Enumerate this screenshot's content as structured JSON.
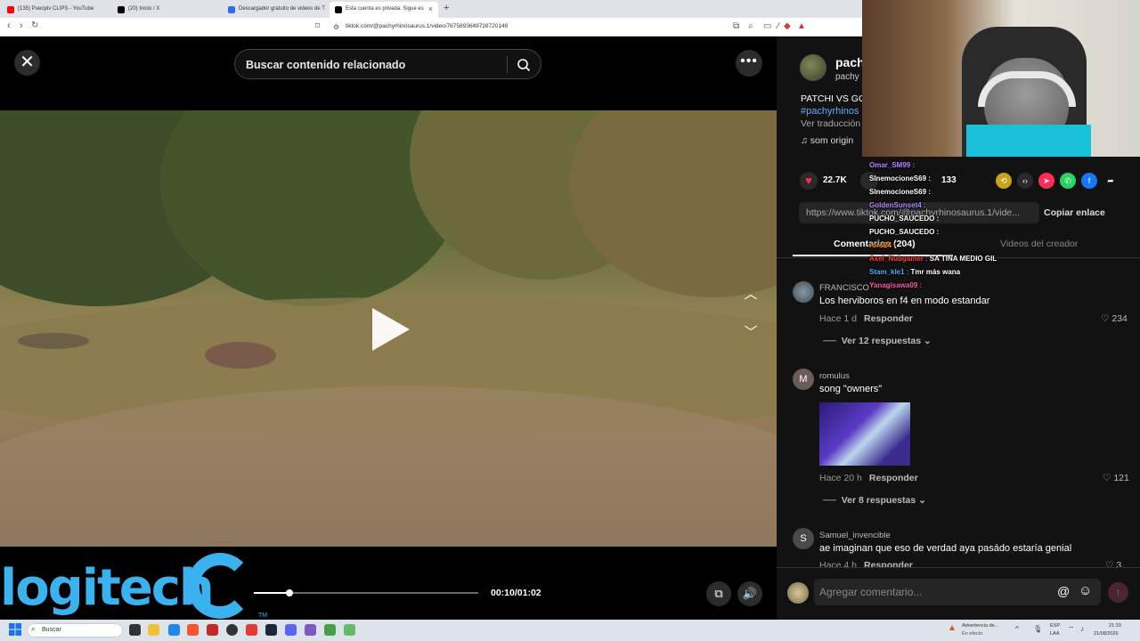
{
  "browser": {
    "tabs": [
      {
        "label": "(135) Pueoplv CLIPS - YouTube",
        "color": "#ff0000"
      },
      {
        "label": "(20) Inicio / X",
        "color": "#000000"
      },
      {
        "label": "Descargador gratuito de videos de T",
        "color": "#2a6df4"
      },
      {
        "label": "Esta cuenta es privada. Sigue es",
        "color": "#000000"
      }
    ],
    "new_tab": "+",
    "url": "tiktok.com/@pachyrhinosaurus.1/video/7675893649728720149"
  },
  "tiktok": {
    "search_placeholder": "Buscar contenido relacionado",
    "more_label": "•••",
    "time": "00:10/01:02",
    "progress": 0.16,
    "author_name": "pach",
    "author_handle": "pachy",
    "description": "PATCHI VS GO",
    "hashtag": "#pachyrhinos",
    "translate": "Ver traducción",
    "sound": "♫  som origin",
    "likes": "22.7K",
    "comments_count": "133",
    "link": "https://www.tiktok.com/@pachyrhinosaurus.1/vide...",
    "copy_link": "Copiar enlace",
    "tab_comments": "Comentarios (204)",
    "tab_creator": "Videos del creador",
    "comments": [
      {
        "avatar": "",
        "user": "FRANCISCO",
        "text": "Los herviboros en f4 en modo estandar",
        "time": "Hace 1 d",
        "reply": "Responder",
        "likes": "234",
        "more": "Ver 12 respuestas"
      },
      {
        "avatar": "M",
        "user": "romulus",
        "text": "song \"owners\"",
        "time": "Hace 20 h",
        "reply": "Responder",
        "likes": "121",
        "more": "Ver 8 respuestas"
      },
      {
        "avatar": "S",
        "user": "Samuel_invencible",
        "text": "ae imaginan que eso de verdad aya pasádo estaría genial",
        "time": "Hace 4 h",
        "reply": "Responder",
        "likes": "3"
      }
    ],
    "composer_placeholder": "Agregar comentario...",
    "accent": "#fe2c55"
  },
  "overlay": {
    "logo": "logitech",
    "logo_tm": "TM",
    "chat": [
      {
        "user": "Omar_SM99 :",
        "msg": "",
        "color": "#b784ff"
      },
      {
        "user": "SInemocioneS69 :",
        "msg": "",
        "color": "#ffffff"
      },
      {
        "user": "SInemocioneS69 :",
        "msg": "",
        "color": "#ffffff"
      },
      {
        "user": "GoldenSunset4 :",
        "msg": "",
        "color": "#b784ff"
      },
      {
        "user": "PUCHO_SAUCEDO :",
        "msg": "",
        "color": "#ffffff"
      },
      {
        "user": "PUCHO_SAUCEDO :",
        "msg": "",
        "color": "#ffffff"
      },
      {
        "user": "roro24 :",
        "msg": "",
        "color": "#ff8c1a"
      },
      {
        "user": "Axel_Nubgamer :",
        "msg": "SA TINA MEDIO GIL",
        "color": "#ff4040"
      },
      {
        "user": "Stam_kle1 :",
        "msg": "Tmr más wana",
        "color": "#3db0ff"
      },
      {
        "user": "Yanagisawa09 :",
        "msg": "",
        "color": "#ff5aa0"
      }
    ]
  },
  "taskbar": {
    "search": "Buscar",
    "alert_title": "Advertencia de...",
    "alert_sub": "En efecto",
    "lang": "ESP",
    "lang_sub": "LAA",
    "time": "21:33",
    "date": "21/08/2026"
  }
}
